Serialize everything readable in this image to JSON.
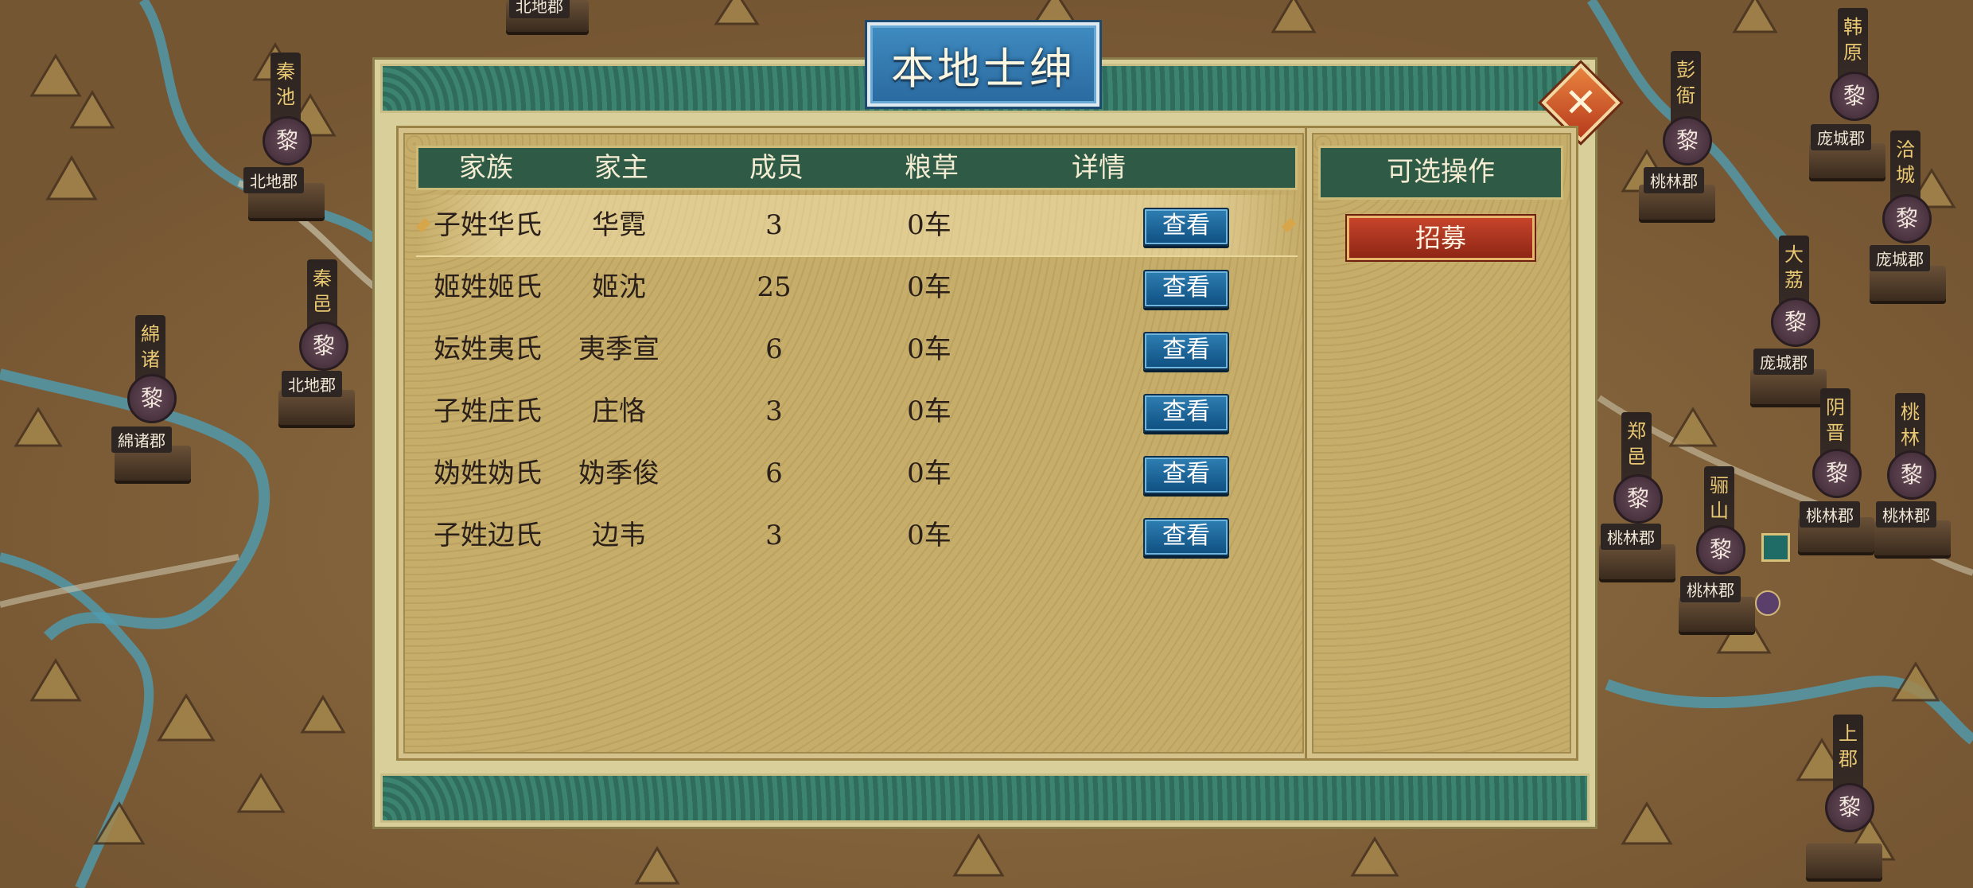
{
  "dialog": {
    "title": "本地士绅",
    "close_icon": "close-icon",
    "table": {
      "headers": [
        "家族",
        "家主",
        "成员",
        "粮草",
        "详情"
      ],
      "rows": [
        {
          "clan": "子姓华氏",
          "head": "华霓",
          "members": "3",
          "food": "0车",
          "action": "查看",
          "selected": true
        },
        {
          "clan": "姬姓姬氏",
          "head": "姬沈",
          "members": "25",
          "food": "0车",
          "action": "查看"
        },
        {
          "clan": "妘姓夷氏",
          "head": "夷季宣",
          "members": "6",
          "food": "0车",
          "action": "查看"
        },
        {
          "clan": "子姓庄氏",
          "head": "庄恪",
          "members": "3",
          "food": "0车",
          "action": "查看"
        },
        {
          "clan": "妫姓妫氏",
          "head": "妫季俊",
          "members": "6",
          "food": "0车",
          "action": "查看"
        },
        {
          "clan": "子姓边氏",
          "head": "边韦",
          "members": "3",
          "food": "0车",
          "action": "查看"
        }
      ]
    },
    "ops": {
      "title": "可选操作",
      "recruit_label": "招募"
    }
  },
  "map": {
    "seal_char": "黎",
    "labels": [
      {
        "vertical": "秦池",
        "city": "北地郡"
      },
      {
        "vertical": "秦邑",
        "city": "北地郡"
      },
      {
        "vertical": "綿诸",
        "city": "綿诸郡"
      },
      {
        "vertical": "彭衙",
        "city": "桃林郡"
      },
      {
        "vertical": "韩原",
        "city": "庞城郡"
      },
      {
        "vertical": "洽城",
        "city": "庞城郡"
      },
      {
        "vertical": "大荔",
        "city": "庞城郡"
      },
      {
        "vertical": "郑邑",
        "city": "桃林郡"
      },
      {
        "vertical": "骊山",
        "city": "桃林郡"
      },
      {
        "vertical": "阴晋",
        "city": "桃林郡"
      },
      {
        "vertical": "桃林",
        "city": "桃林郡"
      },
      {
        "vertical": "上郡",
        "city": ""
      }
    ],
    "top_partial": "北地郡",
    "edge_partials": [
      "庞城",
      "上郡"
    ]
  },
  "colors": {
    "panel_green": "#2f5a45",
    "parchment": "#c6ad6a",
    "button_blue": "#0e4f80",
    "recruit_red": "#a8321c",
    "title_blue": "#2a6aa0",
    "close_orange": "#d9632d"
  }
}
